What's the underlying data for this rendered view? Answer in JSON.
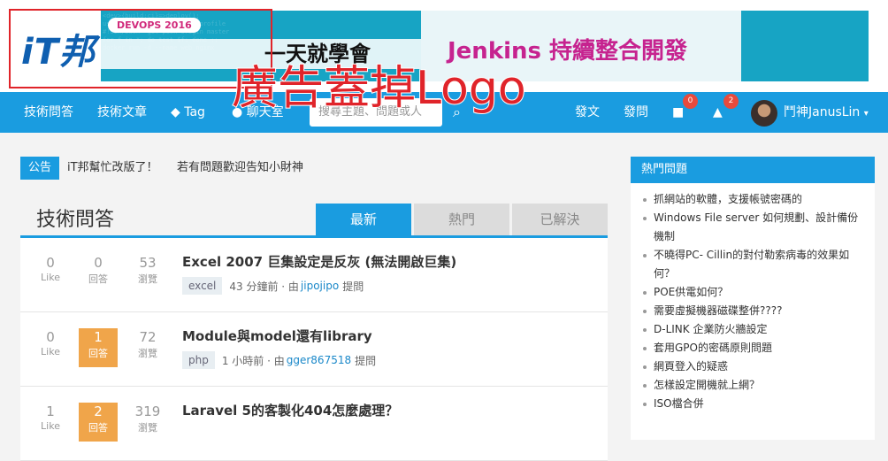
{
  "header": {
    "logo_text": "iT邦",
    "ad_badge": "DEVOPS 2016",
    "ad_title": "一天就學會",
    "ad2_title": "Jenkins 持續整合開發",
    "overlay_note": "廣告蓋掉Logo"
  },
  "nav": {
    "qa": "技術問答",
    "articles": "技術文章",
    "tag": "Tag",
    "chat": "聊天室",
    "search_placeholder": "搜尋主題、問題或人",
    "post": "發文",
    "ask": "發問",
    "messages_count": "0",
    "notifications_count": "2",
    "user_name": "鬥神JanusLin"
  },
  "announcement": {
    "label": "公告",
    "item1": "iT邦幫忙改版了！",
    "item2": "若有問題歡迎告知小財神"
  },
  "main": {
    "title": "技術問答",
    "tabs": [
      "最新",
      "熱門",
      "已解決"
    ],
    "questions": [
      {
        "likes": "0",
        "like_label": "Like",
        "answers": "0",
        "answer_label": "回答",
        "views": "53",
        "view_label": "瀏覽",
        "title": "Excel 2007 巨集設定是反灰 (無法開啟巨集)",
        "tag": "excel",
        "time": "43 分鐘前 · 由",
        "user": "jipojipo",
        "action": "提問"
      },
      {
        "likes": "0",
        "like_label": "Like",
        "answers": "1",
        "answer_label": "回答",
        "views": "72",
        "view_label": "瀏覽",
        "title": "Module與model還有library",
        "tag": "php",
        "time": "1 小時前 · 由",
        "user": "gger867518",
        "action": "提問"
      },
      {
        "likes": "1",
        "like_label": "Like",
        "answers": "2",
        "answer_label": "回答",
        "views": "319",
        "view_label": "瀏覽",
        "title": "Laravel 5的客製化404怎麼處理？",
        "tag": "",
        "time": "",
        "user": "",
        "action": ""
      }
    ]
  },
  "sidebar": {
    "title": "熱門問題",
    "items": [
      "抓網站的軟體，支援帳號密碼的",
      "Windows File server 如何規劃、設計備份機制",
      "不曉得PC- Cillin的對付勒索病毒的效果如何？",
      "POE供電如何？",
      "需要虛擬機器磁碟整併????",
      "D-LINK 企業防火牆設定",
      "套用GPO的密碼原則問題",
      "網頁登入的疑惑",
      "怎樣設定開機就上網？",
      "ISO檔合併"
    ]
  },
  "colors": {
    "primary": "#1a9ce0",
    "accent": "#f0a54a",
    "alert": "#e0242a"
  }
}
